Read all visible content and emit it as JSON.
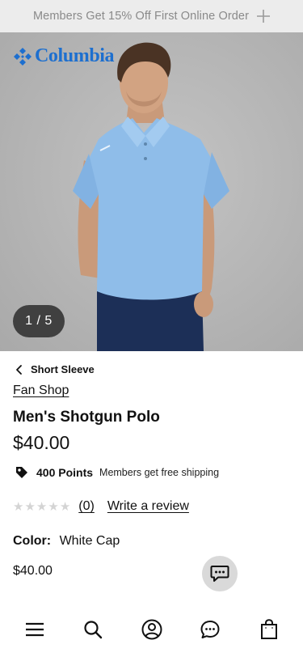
{
  "promo": {
    "text": "Members Get 15% Off First Online Order",
    "expand_icon": "plus-icon"
  },
  "brand": {
    "logo_text": "Columbia",
    "logo_icon": "columbia-diamond-icon",
    "color": "#1d6fcf"
  },
  "gallery": {
    "pager_text": "1 / 5",
    "current": 1,
    "total": 5
  },
  "breadcrumb": {
    "label": "Short Sleeve",
    "icon": "chevron-left-icon"
  },
  "product": {
    "brand_link": "Fan Shop",
    "name": "Men's Shotgun Polo",
    "price": "$40.00"
  },
  "rewards": {
    "points": "400 Points",
    "shipping_note": "Members get free shipping",
    "icon": "tag-icon"
  },
  "rating": {
    "stars": 0,
    "max_stars": 5,
    "count_label": "(0)",
    "write_review_label": "Write a review"
  },
  "color": {
    "label": "Color:",
    "value": "White Cap"
  },
  "variant_price": "$40.00",
  "chat_fab": {
    "icon": "chat-bubble-icon"
  },
  "bottom_nav": {
    "items": [
      {
        "icon": "menu-icon"
      },
      {
        "icon": "search-icon"
      },
      {
        "icon": "account-icon"
      },
      {
        "icon": "chat-icon"
      },
      {
        "icon": "shopping-bag-icon"
      }
    ]
  }
}
